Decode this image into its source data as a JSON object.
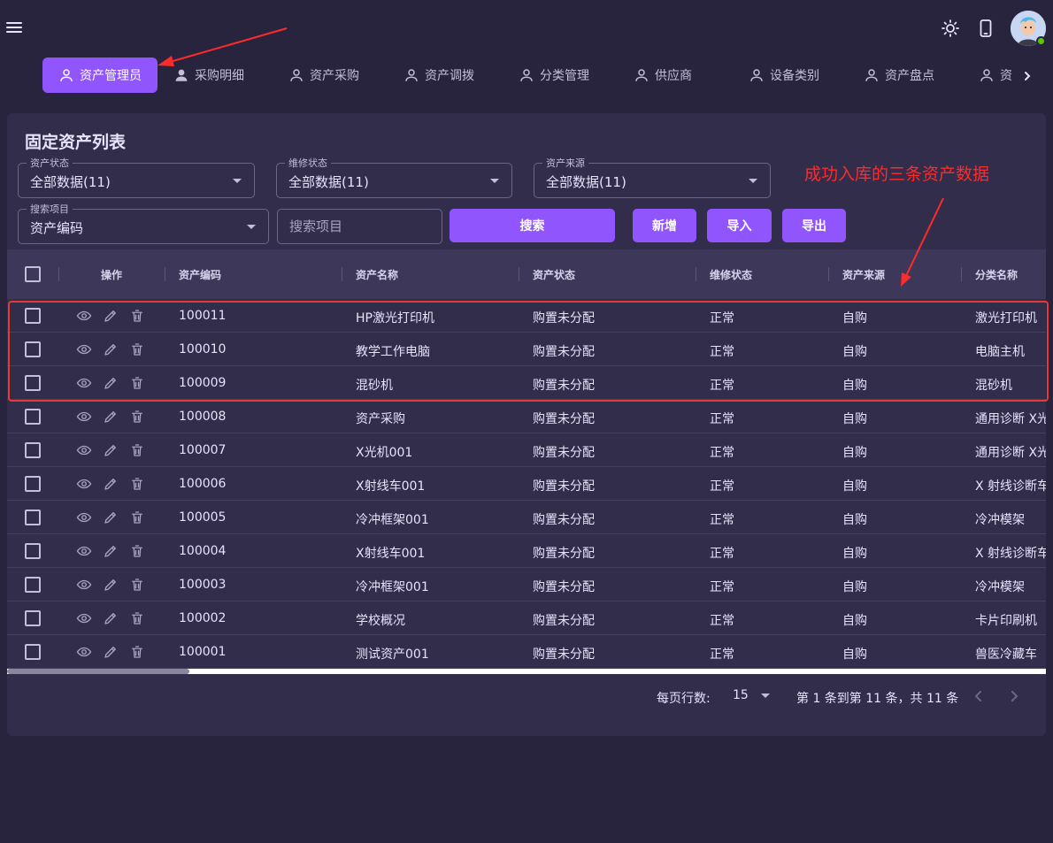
{
  "header": {
    "icons": [
      "menu-icon",
      "brightness-icon",
      "phone-icon",
      "avatar"
    ]
  },
  "tabs": [
    {
      "label": "资产管理员",
      "active": true
    },
    {
      "label": "采购明细",
      "active": false
    },
    {
      "label": "资产采购",
      "active": false
    },
    {
      "label": "资产调拨",
      "active": false
    },
    {
      "label": "分类管理",
      "active": false
    },
    {
      "label": "供应商",
      "active": false
    },
    {
      "label": "设备类别",
      "active": false
    },
    {
      "label": "资产盘点",
      "active": false
    },
    {
      "label": "资",
      "active": false
    }
  ],
  "card": {
    "title": "固定资产列表"
  },
  "filters": {
    "asset_status": {
      "label": "资产状态",
      "value": "全部数据(11)"
    },
    "repair_status": {
      "label": "维修状态",
      "value": "全部数据(11)"
    },
    "asset_source": {
      "label": "资产来源",
      "value": "全部数据(11)"
    },
    "search_field": {
      "label": "搜索项目",
      "value": "资产编码"
    },
    "search_placeholder": "搜索项目"
  },
  "buttons": {
    "search": "搜索",
    "add": "新增",
    "import": "导入",
    "export": "导出"
  },
  "table": {
    "headers": [
      "操作",
      "资产编码",
      "资产名称",
      "资产状态",
      "维修状态",
      "资产来源",
      "分类名称"
    ],
    "rows": [
      {
        "code": "100011",
        "name": "HP激光打印机",
        "status": "购置未分配",
        "repair": "正常",
        "source": "自购",
        "category": "激光打印机"
      },
      {
        "code": "100010",
        "name": "教学工作电脑",
        "status": "购置未分配",
        "repair": "正常",
        "source": "自购",
        "category": "电脑主机"
      },
      {
        "code": "100009",
        "name": "混砂机",
        "status": "购置未分配",
        "repair": "正常",
        "source": "自购",
        "category": "混砂机"
      },
      {
        "code": "100008",
        "name": "资产采购",
        "status": "购置未分配",
        "repair": "正常",
        "source": "自购",
        "category": "通用诊断 X光"
      },
      {
        "code": "100007",
        "name": "X光机001",
        "status": "购置未分配",
        "repair": "正常",
        "source": "自购",
        "category": "通用诊断 X光"
      },
      {
        "code": "100006",
        "name": "X射线车001",
        "status": "购置未分配",
        "repair": "正常",
        "source": "自购",
        "category": "X 射线诊断车"
      },
      {
        "code": "100005",
        "name": "冷冲框架001",
        "status": "购置未分配",
        "repair": "正常",
        "source": "自购",
        "category": "冷冲模架"
      },
      {
        "code": "100004",
        "name": "X射线车001",
        "status": "购置未分配",
        "repair": "正常",
        "source": "自购",
        "category": "X 射线诊断车"
      },
      {
        "code": "100003",
        "name": "冷冲框架001",
        "status": "购置未分配",
        "repair": "正常",
        "source": "自购",
        "category": "冷冲模架"
      },
      {
        "code": "100002",
        "name": "学校概况",
        "status": "购置未分配",
        "repair": "正常",
        "source": "自购",
        "category": "卡片印刷机"
      },
      {
        "code": "100001",
        "name": "测试资产001",
        "status": "购置未分配",
        "repair": "正常",
        "source": "自购",
        "category": "兽医冷藏车"
      }
    ]
  },
  "footer": {
    "rows_per_page_label": "每页行数:",
    "rows_per_page_value": "15",
    "range_text": "第 1 条到第 11 条，共 11 条"
  },
  "annotation": {
    "text": "成功入库的三条资产数据"
  },
  "colors": {
    "background": "#28243d",
    "card": "#312d4b",
    "accent": "#9155fd",
    "annotation": "#ff2a2a"
  }
}
